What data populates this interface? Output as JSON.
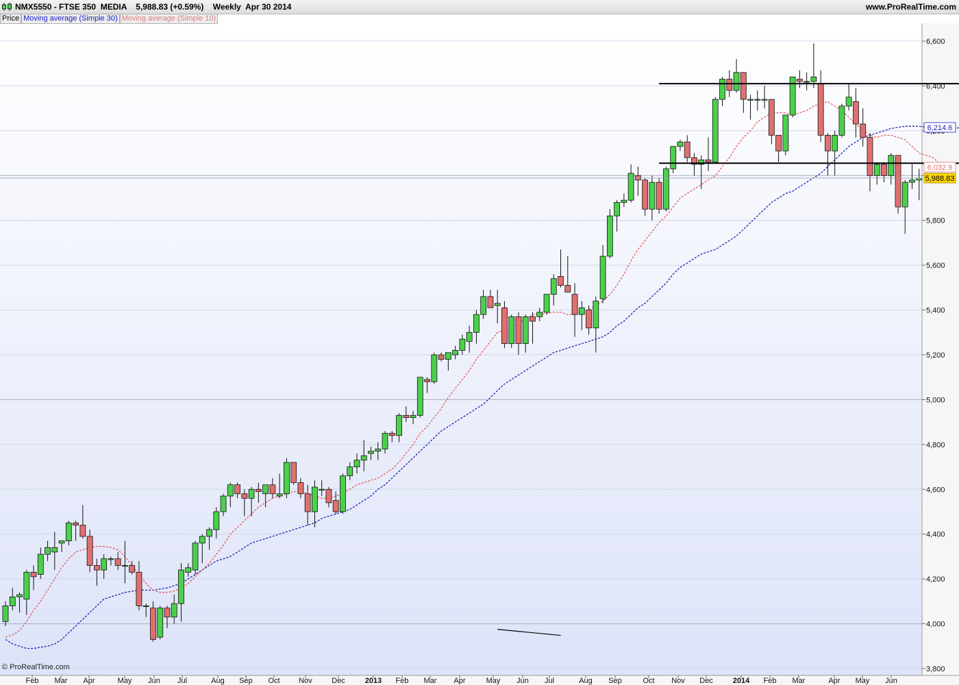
{
  "header": {
    "instrument": "NMX5550 - FTSE 350  MEDIA",
    "last": "5,988.83 (+0.59%)",
    "period_date": "Weekly  Apr 30 2014",
    "website": "www.ProRealTime.com"
  },
  "legend": {
    "price": "Price",
    "ma30": "Moving average (Simple 30)",
    "ma10": "Moving average (Simple 10)"
  },
  "copyright": "© ProRealTime.com",
  "colors": {
    "up": "#4cd04c",
    "down": "#e07070",
    "ma30": "#2020b0",
    "ma10": "#e06060",
    "last_tag": "#ffd700"
  },
  "chart_data": {
    "type": "candlestick",
    "timeframe": "Weekly",
    "y_axis": {
      "range": [
        3800,
        6650
      ],
      "ticks": [
        3800,
        4000,
        4200,
        4400,
        4600,
        4800,
        5000,
        5200,
        5400,
        5600,
        5800,
        6000,
        6200,
        6400,
        6600
      ],
      "tick_labels": [
        "3,800",
        "4,000",
        "4,200",
        "4,400",
        "4,600",
        "4,800",
        "5,000",
        "5,200",
        "5,400",
        "5,600",
        "5,800",
        "6,000",
        "6,200",
        "6,400",
        "6,600"
      ]
    },
    "x_axis_labels": [
      "Feb",
      "Mar",
      "Apr",
      "May",
      "Jun",
      "Jul",
      "Aug",
      "Sep",
      "Oct",
      "Nov",
      "Dec",
      "2013",
      "Feb",
      "Mar",
      "Apr",
      "May",
      "Jun",
      "Jul",
      "Aug",
      "Sep",
      "Oct",
      "Nov",
      "Dec",
      "2014",
      "Feb",
      "Mar",
      "Apr",
      "May",
      "Jun"
    ],
    "bold_x_labels": [
      "2013",
      "2014"
    ],
    "candles": [
      {
        "o": 4010,
        "h": 4100,
        "l": 3990,
        "c": 4080
      },
      {
        "o": 4080,
        "h": 4160,
        "l": 4060,
        "c": 4120
      },
      {
        "o": 4120,
        "h": 4140,
        "l": 4050,
        "c": 4130
      },
      {
        "o": 4110,
        "h": 4240,
        "l": 4040,
        "c": 4230
      },
      {
        "o": 4230,
        "h": 4260,
        "l": 4150,
        "c": 4210
      },
      {
        "o": 4220,
        "h": 4340,
        "l": 4200,
        "c": 4310
      },
      {
        "o": 4310,
        "h": 4370,
        "l": 4280,
        "c": 4340
      },
      {
        "o": 4320,
        "h": 4410,
        "l": 4240,
        "c": 4340
      },
      {
        "o": 4360,
        "h": 4370,
        "l": 4320,
        "c": 4370
      },
      {
        "o": 4370,
        "h": 4460,
        "l": 4350,
        "c": 4450
      },
      {
        "o": 4450,
        "h": 4460,
        "l": 4370,
        "c": 4440
      },
      {
        "o": 4440,
        "h": 4530,
        "l": 4380,
        "c": 4390
      },
      {
        "o": 4390,
        "h": 4420,
        "l": 4230,
        "c": 4260
      },
      {
        "o": 4260,
        "h": 4290,
        "l": 4170,
        "c": 4240
      },
      {
        "o": 4240,
        "h": 4310,
        "l": 4200,
        "c": 4290
      },
      {
        "o": 4290,
        "h": 4300,
        "l": 4260,
        "c": 4290
      },
      {
        "o": 4290,
        "h": 4320,
        "l": 4240,
        "c": 4260
      },
      {
        "o": 4260,
        "h": 4370,
        "l": 4180,
        "c": 4260
      },
      {
        "o": 4260,
        "h": 4280,
        "l": 4220,
        "c": 4230
      },
      {
        "o": 4230,
        "h": 4280,
        "l": 4060,
        "c": 4080
      },
      {
        "o": 4080,
        "h": 4090,
        "l": 4030,
        "c": 4080
      },
      {
        "o": 4070,
        "h": 4100,
        "l": 3920,
        "c": 3930
      },
      {
        "o": 3940,
        "h": 4080,
        "l": 3930,
        "c": 4070
      },
      {
        "o": 4070,
        "h": 4080,
        "l": 3980,
        "c": 4030
      },
      {
        "o": 4030,
        "h": 4130,
        "l": 4000,
        "c": 4090
      },
      {
        "o": 4090,
        "h": 4270,
        "l": 4010,
        "c": 4240
      },
      {
        "o": 4230,
        "h": 4270,
        "l": 4210,
        "c": 4250
      },
      {
        "o": 4240,
        "h": 4370,
        "l": 4220,
        "c": 4360
      },
      {
        "o": 4360,
        "h": 4400,
        "l": 4270,
        "c": 4390
      },
      {
        "o": 4390,
        "h": 4430,
        "l": 4330,
        "c": 4420
      },
      {
        "o": 4420,
        "h": 4520,
        "l": 4380,
        "c": 4500
      },
      {
        "o": 4500,
        "h": 4580,
        "l": 4480,
        "c": 4570
      },
      {
        "o": 4570,
        "h": 4630,
        "l": 4520,
        "c": 4620
      },
      {
        "o": 4620,
        "h": 4630,
        "l": 4560,
        "c": 4580
      },
      {
        "o": 4580,
        "h": 4600,
        "l": 4480,
        "c": 4560
      },
      {
        "o": 4560,
        "h": 4610,
        "l": 4480,
        "c": 4600
      },
      {
        "o": 4600,
        "h": 4630,
        "l": 4540,
        "c": 4590
      },
      {
        "o": 4580,
        "h": 4620,
        "l": 4520,
        "c": 4620
      },
      {
        "o": 4620,
        "h": 4650,
        "l": 4560,
        "c": 4580
      },
      {
        "o": 4570,
        "h": 4670,
        "l": 4560,
        "c": 4580
      },
      {
        "o": 4580,
        "h": 4740,
        "l": 4560,
        "c": 4720
      },
      {
        "o": 4720,
        "h": 4720,
        "l": 4620,
        "c": 4630
      },
      {
        "o": 4630,
        "h": 4650,
        "l": 4560,
        "c": 4580
      },
      {
        "o": 4580,
        "h": 4620,
        "l": 4440,
        "c": 4500
      },
      {
        "o": 4500,
        "h": 4640,
        "l": 4430,
        "c": 4610
      },
      {
        "o": 4600,
        "h": 4640,
        "l": 4570,
        "c": 4600
      },
      {
        "o": 4600,
        "h": 4610,
        "l": 4520,
        "c": 4540
      },
      {
        "o": 4550,
        "h": 4590,
        "l": 4490,
        "c": 4500
      },
      {
        "o": 4500,
        "h": 4670,
        "l": 4490,
        "c": 4660
      },
      {
        "o": 4660,
        "h": 4720,
        "l": 4640,
        "c": 4700
      },
      {
        "o": 4700,
        "h": 4760,
        "l": 4670,
        "c": 4730
      },
      {
        "o": 4730,
        "h": 4820,
        "l": 4680,
        "c": 4750
      },
      {
        "o": 4760,
        "h": 4790,
        "l": 4730,
        "c": 4770
      },
      {
        "o": 4770,
        "h": 4810,
        "l": 4730,
        "c": 4780
      },
      {
        "o": 4780,
        "h": 4860,
        "l": 4760,
        "c": 4850
      },
      {
        "o": 4850,
        "h": 4860,
        "l": 4810,
        "c": 4840
      },
      {
        "o": 4840,
        "h": 4940,
        "l": 4810,
        "c": 4930
      },
      {
        "o": 4930,
        "h": 4970,
        "l": 4900,
        "c": 4920
      },
      {
        "o": 4920,
        "h": 4950,
        "l": 4890,
        "c": 4930
      },
      {
        "o": 4930,
        "h": 5100,
        "l": 4920,
        "c": 5100
      },
      {
        "o": 5090,
        "h": 5100,
        "l": 5030,
        "c": 5080
      },
      {
        "o": 5080,
        "h": 5210,
        "l": 5070,
        "c": 5200
      },
      {
        "o": 5200,
        "h": 5210,
        "l": 5170,
        "c": 5180
      },
      {
        "o": 5180,
        "h": 5210,
        "l": 5130,
        "c": 5210
      },
      {
        "o": 5200,
        "h": 5240,
        "l": 5180,
        "c": 5220
      },
      {
        "o": 5220,
        "h": 5290,
        "l": 5200,
        "c": 5270
      },
      {
        "o": 5260,
        "h": 5330,
        "l": 5210,
        "c": 5300
      },
      {
        "o": 5300,
        "h": 5400,
        "l": 5250,
        "c": 5380
      },
      {
        "o": 5380,
        "h": 5490,
        "l": 5360,
        "c": 5460
      },
      {
        "o": 5460,
        "h": 5490,
        "l": 5410,
        "c": 5410
      },
      {
        "o": 5420,
        "h": 5490,
        "l": 5340,
        "c": 5430
      },
      {
        "o": 5410,
        "h": 5440,
        "l": 5230,
        "c": 5250
      },
      {
        "o": 5250,
        "h": 5380,
        "l": 5230,
        "c": 5370
      },
      {
        "o": 5370,
        "h": 5390,
        "l": 5200,
        "c": 5250
      },
      {
        "o": 5250,
        "h": 5380,
        "l": 5210,
        "c": 5370
      },
      {
        "o": 5370,
        "h": 5390,
        "l": 5250,
        "c": 5350
      },
      {
        "o": 5370,
        "h": 5410,
        "l": 5350,
        "c": 5390
      },
      {
        "o": 5390,
        "h": 5470,
        "l": 5380,
        "c": 5470
      },
      {
        "o": 5470,
        "h": 5560,
        "l": 5420,
        "c": 5540
      },
      {
        "o": 5550,
        "h": 5670,
        "l": 5500,
        "c": 5510
      },
      {
        "o": 5510,
        "h": 5640,
        "l": 5480,
        "c": 5480
      },
      {
        "o": 5470,
        "h": 5520,
        "l": 5280,
        "c": 5380
      },
      {
        "o": 5380,
        "h": 5440,
        "l": 5310,
        "c": 5410
      },
      {
        "o": 5400,
        "h": 5420,
        "l": 5290,
        "c": 5320
      },
      {
        "o": 5320,
        "h": 5460,
        "l": 5210,
        "c": 5440
      },
      {
        "o": 5450,
        "h": 5690,
        "l": 5430,
        "c": 5640
      },
      {
        "o": 5640,
        "h": 5850,
        "l": 5630,
        "c": 5820
      },
      {
        "o": 5820,
        "h": 5890,
        "l": 5750,
        "c": 5880
      },
      {
        "o": 5880,
        "h": 5920,
        "l": 5860,
        "c": 5890
      },
      {
        "o": 5890,
        "h": 6050,
        "l": 5880,
        "c": 6010
      },
      {
        "o": 6000,
        "h": 6040,
        "l": 5910,
        "c": 5980
      },
      {
        "o": 5980,
        "h": 5990,
        "l": 5820,
        "c": 5850
      },
      {
        "o": 5850,
        "h": 6000,
        "l": 5800,
        "c": 5970
      },
      {
        "o": 5970,
        "h": 5990,
        "l": 5830,
        "c": 5850
      },
      {
        "o": 5850,
        "h": 6040,
        "l": 5840,
        "c": 6030
      },
      {
        "o": 6030,
        "h": 6130,
        "l": 6010,
        "c": 6130
      },
      {
        "o": 6130,
        "h": 6160,
        "l": 6110,
        "c": 6150
      },
      {
        "o": 6150,
        "h": 6180,
        "l": 6060,
        "c": 6080
      },
      {
        "o": 6080,
        "h": 6100,
        "l": 6000,
        "c": 6050
      },
      {
        "o": 6050,
        "h": 6090,
        "l": 5940,
        "c": 6070
      },
      {
        "o": 6070,
        "h": 6170,
        "l": 6020,
        "c": 6060
      },
      {
        "o": 6060,
        "h": 6350,
        "l": 6070,
        "c": 6340
      },
      {
        "o": 6340,
        "h": 6440,
        "l": 6310,
        "c": 6430
      },
      {
        "o": 6430,
        "h": 6470,
        "l": 6350,
        "c": 6380
      },
      {
        "o": 6380,
        "h": 6520,
        "l": 6370,
        "c": 6460
      },
      {
        "o": 6460,
        "h": 6460,
        "l": 6280,
        "c": 6340
      },
      {
        "o": 6340,
        "h": 6360,
        "l": 6250,
        "c": 6340
      },
      {
        "o": 6340,
        "h": 6380,
        "l": 6290,
        "c": 6340
      },
      {
        "o": 6340,
        "h": 6400,
        "l": 6300,
        "c": 6340
      },
      {
        "o": 6340,
        "h": 6330,
        "l": 6140,
        "c": 6180
      },
      {
        "o": 6180,
        "h": 6180,
        "l": 6060,
        "c": 6110
      },
      {
        "o": 6110,
        "h": 6270,
        "l": 6090,
        "c": 6270
      },
      {
        "o": 6270,
        "h": 6440,
        "l": 6260,
        "c": 6440
      },
      {
        "o": 6430,
        "h": 6470,
        "l": 6390,
        "c": 6420
      },
      {
        "o": 6420,
        "h": 6460,
        "l": 6380,
        "c": 6420
      },
      {
        "o": 6420,
        "h": 6590,
        "l": 6390,
        "c": 6440
      },
      {
        "o": 6410,
        "h": 6470,
        "l": 6150,
        "c": 6180
      },
      {
        "o": 6180,
        "h": 6190,
        "l": 6000,
        "c": 6110
      },
      {
        "o": 6110,
        "h": 6200,
        "l": 6000,
        "c": 6180
      },
      {
        "o": 6180,
        "h": 6320,
        "l": 6170,
        "c": 6310
      },
      {
        "o": 6310,
        "h": 6410,
        "l": 6290,
        "c": 6350
      },
      {
        "o": 6330,
        "h": 6390,
        "l": 6170,
        "c": 6230
      },
      {
        "o": 6230,
        "h": 6300,
        "l": 6130,
        "c": 6170
      },
      {
        "o": 6170,
        "h": 6190,
        "l": 5930,
        "c": 6000
      },
      {
        "o": 6000,
        "h": 6060,
        "l": 5960,
        "c": 6050
      },
      {
        "o": 6050,
        "h": 6060,
        "l": 5970,
        "c": 6000
      },
      {
        "o": 6000,
        "h": 6100,
        "l": 5960,
        "c": 6090
      },
      {
        "o": 6090,
        "h": 6090,
        "l": 5830,
        "c": 5860
      },
      {
        "o": 5860,
        "h": 5980,
        "l": 5740,
        "c": 5970
      },
      {
        "o": 5970,
        "h": 6050,
        "l": 5940,
        "c": 5980
      },
      {
        "o": 5980,
        "h": 6030,
        "l": 5890,
        "c": 5989
      }
    ],
    "ma30": [
      3930,
      3910,
      3900,
      3890,
      3890,
      3895,
      3900,
      3910,
      3930,
      3960,
      3990,
      4020,
      4050,
      4080,
      4110,
      4120,
      4130,
      4140,
      4145,
      4150,
      4150,
      4150,
      4155,
      4160,
      4170,
      4180,
      4200,
      4220,
      4240,
      4260,
      4280,
      4290,
      4300,
      4320,
      4340,
      4360,
      4370,
      4380,
      4390,
      4400,
      4410,
      4420,
      4430,
      4440,
      4450,
      4470,
      4480,
      4490,
      4500,
      4510,
      4530,
      4550,
      4570,
      4600,
      4620,
      4650,
      4680,
      4710,
      4740,
      4770,
      4800,
      4830,
      4860,
      4880,
      4900,
      4920,
      4940,
      4960,
      4980,
      5010,
      5040,
      5070,
      5090,
      5110,
      5130,
      5150,
      5170,
      5190,
      5210,
      5220,
      5230,
      5240,
      5250,
      5260,
      5270,
      5280,
      5300,
      5330,
      5350,
      5380,
      5410,
      5430,
      5460,
      5490,
      5520,
      5560,
      5590,
      5610,
      5630,
      5650,
      5660,
      5670,
      5690,
      5710,
      5730,
      5760,
      5790,
      5820,
      5850,
      5880,
      5900,
      5920,
      5930,
      5950,
      5970,
      5990,
      6010,
      6040,
      6070,
      6100,
      6130,
      6150,
      6170,
      6180,
      6190,
      6200,
      6210,
      6215,
      6220,
      6220,
      6220,
      6215,
      6210,
      6210,
      6210,
      6210,
      6215
    ],
    "ma10": [
      3940,
      3950,
      3970,
      4010,
      4060,
      4100,
      4150,
      4200,
      4250,
      4290,
      4320,
      4330,
      4340,
      4345,
      4345,
      4340,
      4330,
      4300,
      4260,
      4220,
      4180,
      4150,
      4140,
      4140,
      4145,
      4160,
      4180,
      4210,
      4240,
      4270,
      4310,
      4350,
      4400,
      4430,
      4460,
      4490,
      4520,
      4540,
      4560,
      4570,
      4580,
      4590,
      4590,
      4580,
      4570,
      4560,
      4560,
      4570,
      4580,
      4600,
      4620,
      4630,
      4640,
      4650,
      4670,
      4690,
      4720,
      4760,
      4800,
      4850,
      4880,
      4920,
      4960,
      5010,
      5050,
      5090,
      5130,
      5180,
      5220,
      5260,
      5300,
      5310,
      5320,
      5340,
      5360,
      5380,
      5380,
      5385,
      5390,
      5390,
      5380,
      5380,
      5390,
      5400,
      5420,
      5440,
      5470,
      5510,
      5560,
      5620,
      5670,
      5710,
      5750,
      5790,
      5820,
      5860,
      5900,
      5920,
      5940,
      5960,
      5980,
      6000,
      6040,
      6080,
      6130,
      6170,
      6200,
      6240,
      6260,
      6280,
      6280,
      6280,
      6270,
      6280,
      6290,
      6310,
      6320,
      6330,
      6310,
      6290,
      6260,
      6230,
      6200,
      6180,
      6170,
      6180,
      6180,
      6170,
      6160,
      6130,
      6100,
      6090,
      6080,
      6050,
      6033
    ],
    "horizontal_lines": [
      {
        "y": 6410,
        "from_index": 93,
        "to_index": 135
      },
      {
        "y": 6055,
        "from_index": 93,
        "to_index": 135
      }
    ],
    "annotation_line": {
      "from": [
        70,
        3975
      ],
      "to": [
        79,
        3948
      ]
    },
    "price_tags": [
      {
        "label": "6,214.6",
        "value": 6214.6,
        "series": "ma30"
      },
      {
        "label": "6,032.9",
        "value": 6032.9,
        "series": "ma10"
      },
      {
        "label": "5,988.83",
        "value": 5988.83,
        "series": "price"
      }
    ],
    "last_price": 5988.83
  }
}
